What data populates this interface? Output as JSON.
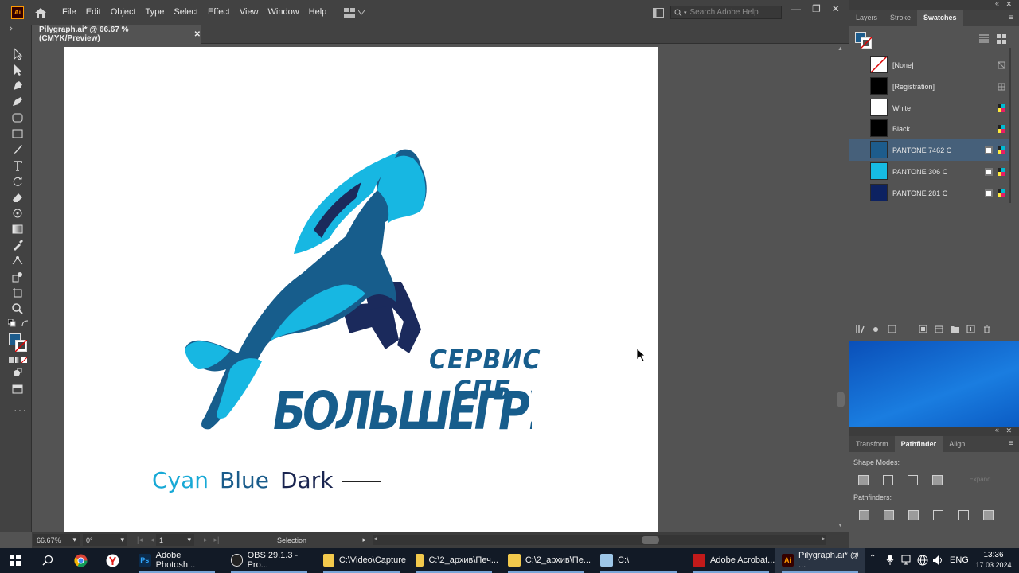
{
  "menubar": {
    "app_icon": "Ai",
    "items": [
      "File",
      "Edit",
      "Object",
      "Type",
      "Select",
      "Effect",
      "View",
      "Window",
      "Help"
    ],
    "search_placeholder": "Search Adobe Help",
    "window_controls": [
      "—",
      "❐",
      "✕"
    ]
  },
  "document_tab": {
    "title": "Pilygraph.ai* @ 66.67 % (CMYK/Preview)",
    "close": "✕"
  },
  "artwork": {
    "service_text": "СЕРВИС СПБ",
    "brand_text": "БОЛЬШЕГРУЗ",
    "color_labels": [
      {
        "text": "Cyan",
        "color": "#18a9d6"
      },
      {
        "text": "Blue",
        "color": "#1a5c8b"
      },
      {
        "text": "Dark",
        "color": "#1a2550"
      }
    ],
    "colors": {
      "cyan": "#17b7e2",
      "blue": "#175d8c",
      "dark": "#1b2a5c"
    }
  },
  "swatches_panel": {
    "tabs": [
      "Layers",
      "Stroke",
      "Swatches"
    ],
    "active_tab": "Swatches",
    "swatches": [
      {
        "name": "[None]",
        "color": "none"
      },
      {
        "name": "[Registration]",
        "color": "#000000"
      },
      {
        "name": "White",
        "color": "#ffffff"
      },
      {
        "name": "Black",
        "color": "#000000"
      },
      {
        "name": "PANTONE 7462 C",
        "color": "#1d5c8c"
      },
      {
        "name": "PANTONE 306 C",
        "color": "#16bbe3"
      },
      {
        "name": "PANTONE 281 C",
        "color": "#0d2261"
      }
    ]
  },
  "pathfinder_panel": {
    "tabs": [
      "Transform",
      "Pathfinder",
      "Align"
    ],
    "active_tab": "Pathfinder",
    "shape_modes_label": "Shape Modes:",
    "expand_label": "Expand",
    "pathfinders_label": "Pathfinders:"
  },
  "statusbar": {
    "zoom": "66.67%",
    "rotation": "0°",
    "artboard": "1",
    "tool": "Selection"
  },
  "taskbar": {
    "items": [
      {
        "label": "Adobe Photosh...",
        "icon": "photoshop-icon",
        "color": "#0b2a4a"
      },
      {
        "label": "OBS 29.1.3 - Pro...",
        "icon": "obs-icon",
        "color": "#222222"
      },
      {
        "label": "C:\\Video\\Capture",
        "icon": "folder-icon",
        "color": "#f2c94c"
      },
      {
        "label": "C:\\2_архив\\Печ...",
        "icon": "folder-icon",
        "color": "#f2c94c"
      },
      {
        "label": "C:\\2_архив\\Пе...",
        "icon": "folder-icon",
        "color": "#f2c94c"
      },
      {
        "label": "C:\\",
        "icon": "drive-icon",
        "color": "#9ec7e8"
      },
      {
        "label": "Adobe Acrobat...",
        "icon": "acrobat-icon",
        "color": "#c21a1a"
      },
      {
        "label": "Pilygraph.ai* @ ...",
        "icon": "illustrator-icon",
        "color": "#330000"
      }
    ],
    "language": "ENG",
    "time": "13:36",
    "date": "17.03.2024"
  }
}
